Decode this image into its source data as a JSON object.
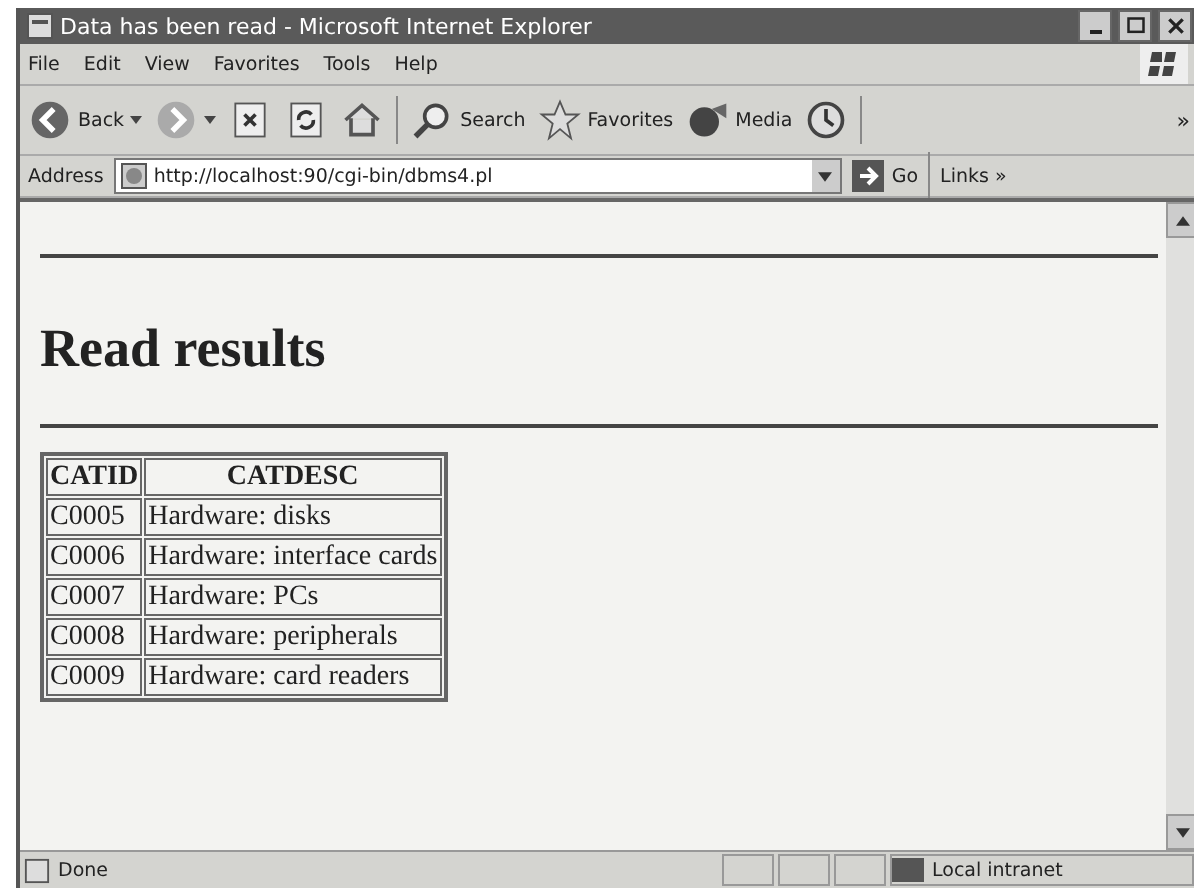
{
  "window": {
    "title": "Data has been read - Microsoft Internet Explorer"
  },
  "menu": [
    "File",
    "Edit",
    "View",
    "Favorites",
    "Tools",
    "Help"
  ],
  "toolbar": [
    {
      "kind": "back",
      "label": "Back"
    },
    {
      "kind": "forward"
    },
    {
      "kind": "stop"
    },
    {
      "kind": "refresh"
    },
    {
      "kind": "home"
    },
    {
      "kind": "search",
      "label": "Search"
    },
    {
      "kind": "favorites",
      "label": "Favorites"
    },
    {
      "kind": "media",
      "label": "Media"
    },
    {
      "kind": "history"
    }
  ],
  "toolbar_more": "»",
  "address": {
    "label": "Address",
    "url": "http://localhost:90/cgi-bin/dbms4.pl",
    "go": "Go",
    "links": "Links",
    "links_more": "»"
  },
  "page": {
    "heading": "Read results",
    "table": {
      "columns": [
        "CATID",
        "CATDESC"
      ],
      "rows": [
        [
          "C0005",
          "Hardware: disks"
        ],
        [
          "C0006",
          "Hardware: interface cards"
        ],
        [
          "C0007",
          "Hardware: PCs"
        ],
        [
          "C0008",
          "Hardware: peripherals"
        ],
        [
          "C0009",
          "Hardware: card readers"
        ]
      ]
    }
  },
  "status_bar": {
    "text": "Done",
    "zone": "Local intranet"
  }
}
